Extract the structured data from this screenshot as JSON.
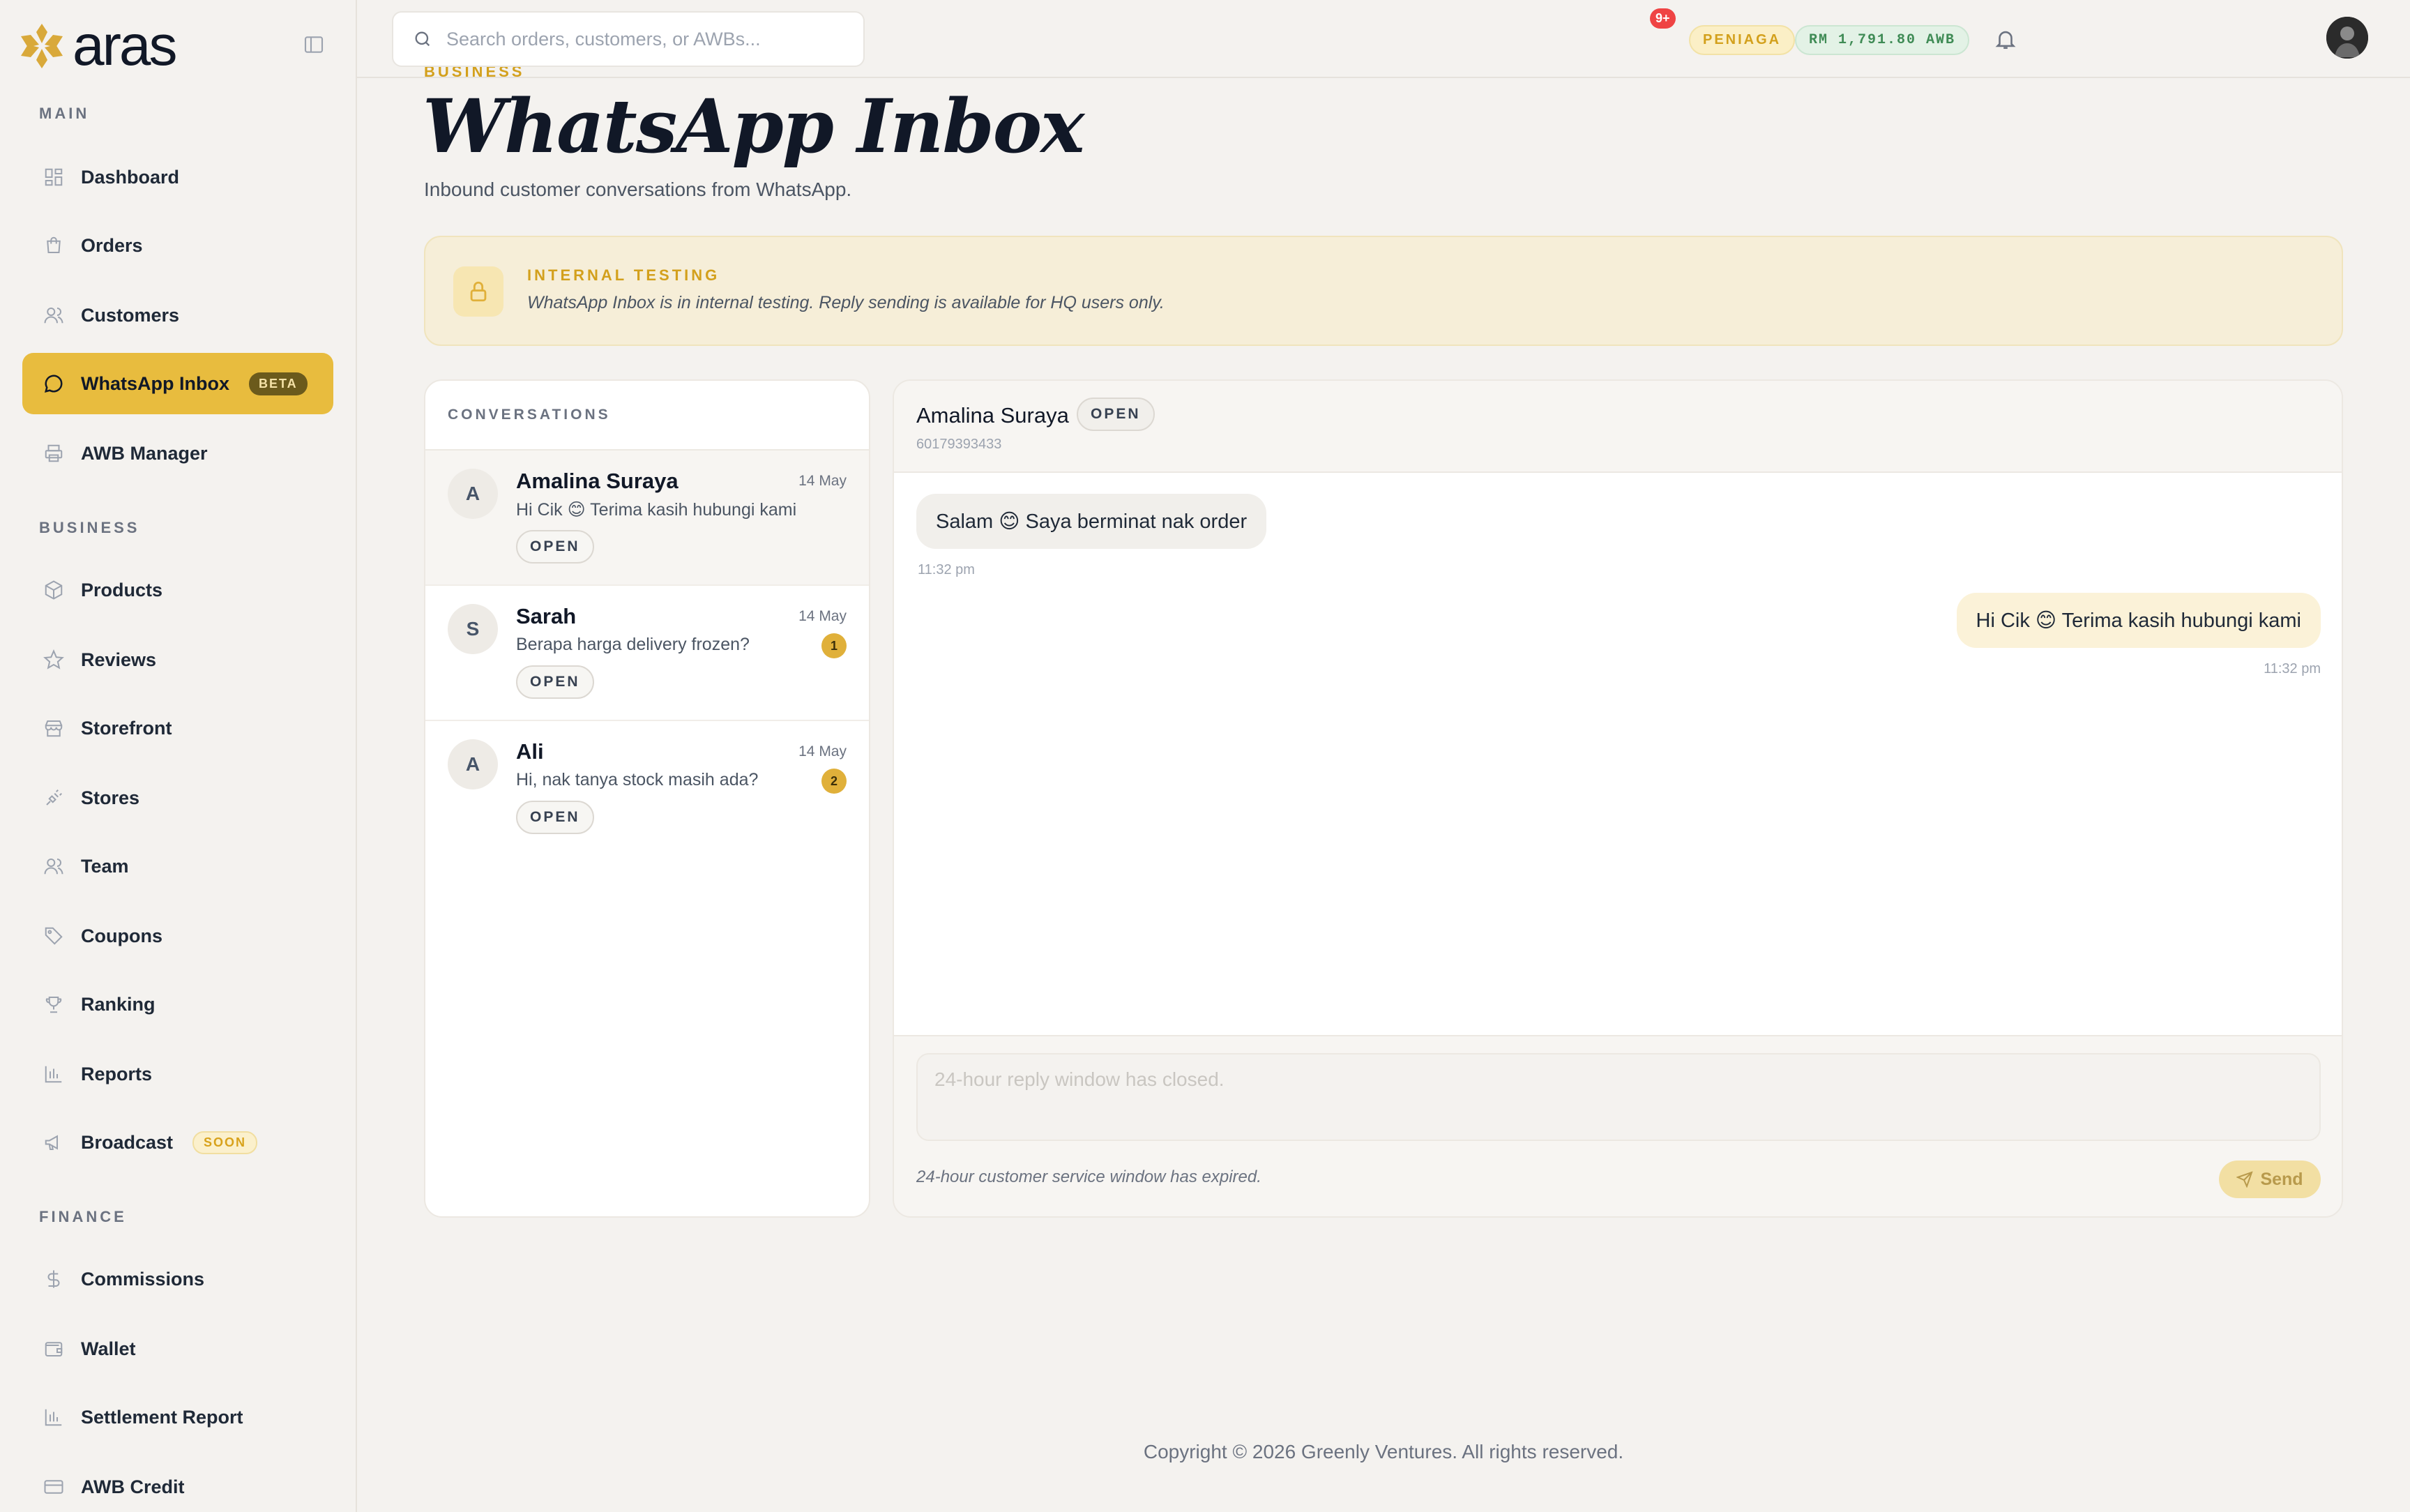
{
  "brand": {
    "name": "aras"
  },
  "sidebar": {
    "sections": [
      {
        "label": "MAIN",
        "items": [
          {
            "label": "Dashboard",
            "icon": "dashboard-icon"
          },
          {
            "label": "Orders",
            "icon": "shopping-bag-icon"
          },
          {
            "label": "Customers",
            "icon": "users-icon"
          },
          {
            "label": "WhatsApp Inbox",
            "icon": "message-circle-icon",
            "badge": "BETA",
            "active": true
          },
          {
            "label": "AWB Manager",
            "icon": "printer-icon"
          }
        ]
      },
      {
        "label": "BUSINESS",
        "items": [
          {
            "label": "Products",
            "icon": "box-icon"
          },
          {
            "label": "Reviews",
            "icon": "star-icon"
          },
          {
            "label": "Storefront",
            "icon": "store-icon"
          },
          {
            "label": "Stores",
            "icon": "plug-icon"
          },
          {
            "label": "Team",
            "icon": "team-icon"
          },
          {
            "label": "Coupons",
            "icon": "tag-icon"
          },
          {
            "label": "Ranking",
            "icon": "trophy-icon"
          },
          {
            "label": "Reports",
            "icon": "bar-chart-icon"
          },
          {
            "label": "Broadcast",
            "icon": "megaphone-icon",
            "badge": "SOON"
          }
        ]
      },
      {
        "label": "FINANCE",
        "items": [
          {
            "label": "Commissions",
            "icon": "dollar-icon"
          },
          {
            "label": "Wallet",
            "icon": "wallet-icon"
          },
          {
            "label": "Settlement Report",
            "icon": "bar-chart-icon"
          },
          {
            "label": "AWB Credit",
            "icon": "credit-card-icon"
          }
        ]
      }
    ]
  },
  "topbar": {
    "search_placeholder": "Search orders, customers, or AWBs...",
    "notification_count": "9+",
    "tier_badge": "PENIAGA",
    "awb_balance": "RM 1,791.80 AWB"
  },
  "page": {
    "breadcrumb": "BUSINESS",
    "title": "WhatsApp Inbox",
    "subtitle": "Inbound customer conversations from WhatsApp."
  },
  "banner": {
    "title": "INTERNAL TESTING",
    "text": "WhatsApp Inbox is in internal testing. Reply sending is available for HQ users only."
  },
  "conversations": {
    "header": "CONVERSATIONS",
    "items": [
      {
        "initial": "A",
        "name": "Amalina Suraya",
        "date": "14 May",
        "preview": "Hi Cik 😊 Terima kasih hubungi kami",
        "status": "OPEN",
        "unread": ""
      },
      {
        "initial": "S",
        "name": "Sarah",
        "date": "14 May",
        "preview": "Berapa harga delivery frozen?",
        "status": "OPEN",
        "unread": "1"
      },
      {
        "initial": "A",
        "name": "Ali",
        "date": "14 May",
        "preview": "Hi, nak tanya stock masih ada?",
        "status": "OPEN",
        "unread": "2"
      }
    ]
  },
  "chat": {
    "name": "Amalina Suraya",
    "status": "OPEN",
    "phone": "60179393433",
    "messages": [
      {
        "direction": "in",
        "text": "Salam 😊 Saya berminat nak order",
        "time": "11:32 pm"
      },
      {
        "direction": "out",
        "text": "Hi Cik 😊 Terima kasih hubungi kami",
        "time": "11:32 pm"
      }
    ],
    "reply_placeholder": "24-hour reply window has closed.",
    "expired_note": "24-hour customer service window has expired.",
    "send_label": "Send"
  },
  "footer": {
    "text": "Copyright © 2026 Greenly Ventures. All rights reserved."
  }
}
